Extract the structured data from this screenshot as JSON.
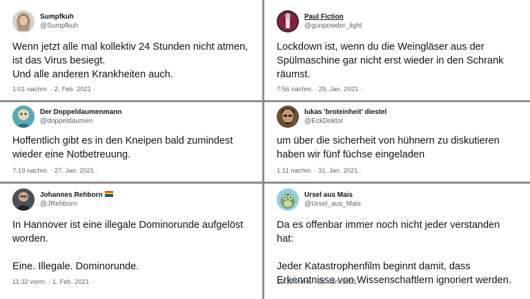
{
  "tweets": [
    {
      "name": "Sumpfkuh",
      "handle": "@Sumpfkuh",
      "text": "Wenn  jetzt alle mal kollektiv 24 Stunden nicht atmen,\nist das Virus besiegt.\nUnd alle anderen Krankheiten auch.",
      "meta": "1:01 nachm. · 2. Feb. 2021 ·",
      "avatar_color": "#c9c2b8"
    },
    {
      "name": "Paul Fiction",
      "handle": "@gunpowder_light",
      "text": "Lockdown ist, wenn du die Weingläser aus der\nSpülmaschine gar nicht erst wieder in den Schrank\nräumst.",
      "meta": "7:56 nachm. · 29. Jan. 2021 ·",
      "avatar_color": "#7a1f3d"
    },
    {
      "name": "Der Doppeldaumenmann",
      "handle": "@doppeldaumen",
      "text": "Hoffentlich gibt es in den Kneipen bald zumindest\nwieder eine Notbetreuung.",
      "meta": "7:19 nachm. · 27. Jan. 2021 ·",
      "avatar_color": "#3f8ea0"
    },
    {
      "name": "lukas 'broteinheit' diestel",
      "handle": "@EckDoktor",
      "text": "um über die sicherheit von hühnern zu diskutieren\nhaben wir fünf füchse eingeladen",
      "meta": "1:11 nachm. · 31. Jan. 2021 ·",
      "avatar_color": "#5a4330"
    },
    {
      "name": "Johannes Rehborn",
      "handle": "@JRehborn",
      "text": "In Hannover ist eine illegale Dominorunde aufgelöst\nworden.\n\nEine. Illegale. Dominorunde.",
      "meta": "11:32 vorm. · 1. Feb. 2021 ·",
      "avatar_color": "#3b3f46"
    },
    {
      "name": "Ursel aus Mais",
      "handle": "@Ursel_aus_Mais",
      "text": "Da es offenbar immer noch nicht jeder verstanden hat:\n\nJeder Katastrophenfilm beginnt damit, dass\nErkenntnisse von Wissenschaftlern ignoriert werden.",
      "meta": "10:32 vorm. · 28. Jan. 2021 ·",
      "avatar_color": "#7cc3d8"
    }
  ]
}
